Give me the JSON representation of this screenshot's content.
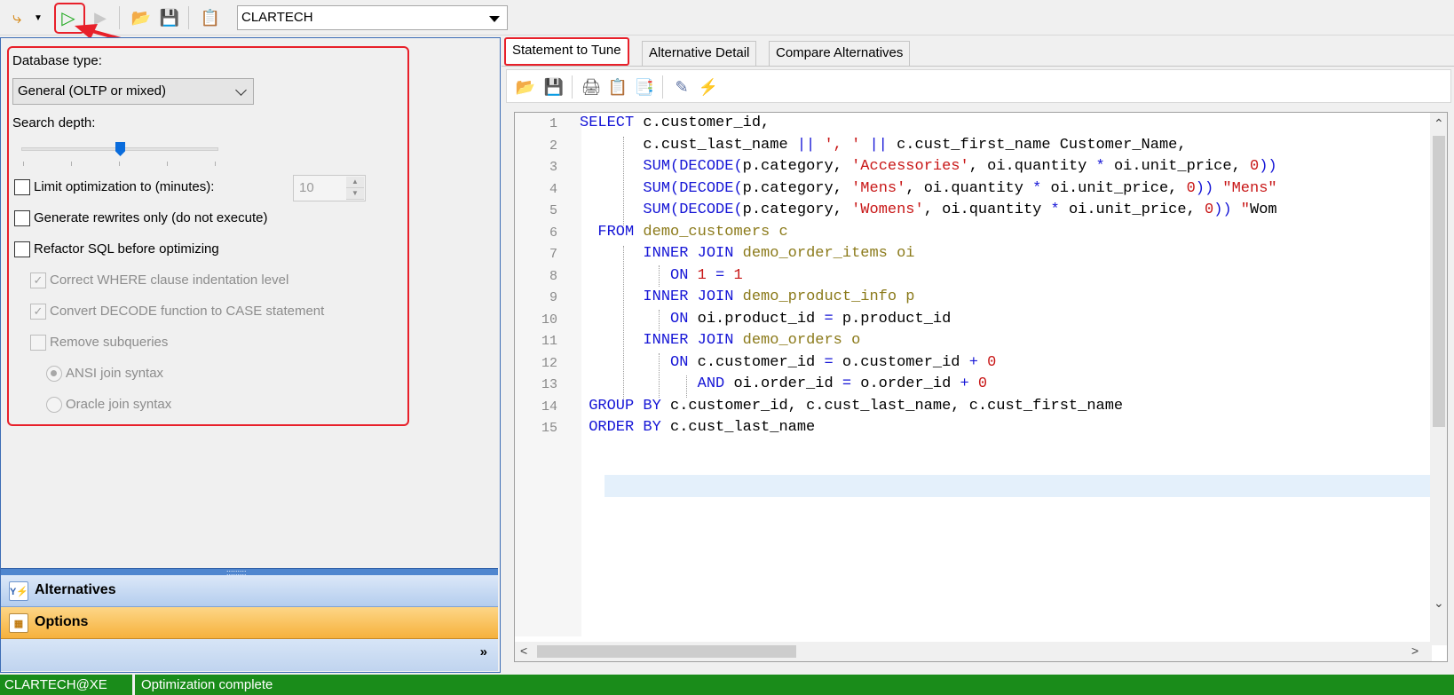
{
  "toolbar": {
    "connection_value": "CLARTECH",
    "icons": [
      "connect-plug-icon",
      "dropdown-arrow-icon",
      "run-icon",
      "stop-icon",
      "open-folder-icon",
      "save-icon",
      "report-icon"
    ]
  },
  "settings": {
    "database_type_label": "Database type:",
    "database_type_value": "General (OLTP or mixed)",
    "search_depth_label": "Search depth:",
    "search_depth_level": 0.5,
    "limit_label": "Limit optimization to (minutes):",
    "limit_value": "10",
    "limit_checked": false,
    "generate_rewrites_label": "Generate rewrites only (do not execute)",
    "generate_rewrites_checked": false,
    "refactor_label": "Refactor SQL before optimizing",
    "refactor_checked": false,
    "correct_where_label": "Correct WHERE clause indentation level",
    "correct_where_checked": true,
    "convert_decode_label": "Convert DECODE function to CASE statement",
    "convert_decode_checked": true,
    "remove_subqueries_label": "Remove subqueries",
    "remove_subqueries_checked": false,
    "ansi_join_label": "ANSI join syntax",
    "ansi_join_selected": true,
    "oracle_join_label": "Oracle join syntax",
    "oracle_join_selected": false
  },
  "navigation": {
    "alternatives_label": "Alternatives",
    "options_label": "Options",
    "overflow_label": "»"
  },
  "tabs": {
    "statement_to_tune": "Statement to Tune",
    "alternative_detail": "Alternative Detail",
    "compare_alternatives": "Compare Alternatives"
  },
  "editor": {
    "line_numbers": [
      "1",
      "2",
      "3",
      "4",
      "5",
      "6",
      "7",
      "8",
      "9",
      "10",
      "11",
      "12",
      "13",
      "14",
      "15"
    ],
    "lines": [
      "SELECT c.customer_id,",
      "       c.cust_last_name || ', ' || c.cust_first_name Customer_Name,",
      "       SUM(DECODE(p.category, 'Accessories', oi.quantity * oi.unit_price, 0))",
      "       SUM(DECODE(p.category, 'Mens', oi.quantity * oi.unit_price, 0)) \"Mens\"",
      "       SUM(DECODE(p.category, 'Womens', oi.quantity * oi.unit_price, 0)) \"Wom",
      "  FROM demo_customers c",
      "       INNER JOIN demo_order_items oi",
      "          ON 1 = 1",
      "       INNER JOIN demo_product_info p",
      "          ON oi.product_id = p.product_id",
      "       INNER JOIN demo_orders o",
      "          ON c.customer_id = o.customer_id + 0",
      "             AND oi.order_id = o.order_id + 0",
      " GROUP BY c.customer_id, c.cust_last_name, c.cust_first_name",
      " ORDER BY c.cust_last_name"
    ]
  },
  "status": {
    "connection": "CLARTECH@XE",
    "message": "Optimization complete"
  },
  "colors": {
    "keyword": "#1515d6",
    "object": "#8b7a1a",
    "string": "#c81717",
    "status_bar": "#1a8c1a",
    "annotation": "#e8202a"
  }
}
